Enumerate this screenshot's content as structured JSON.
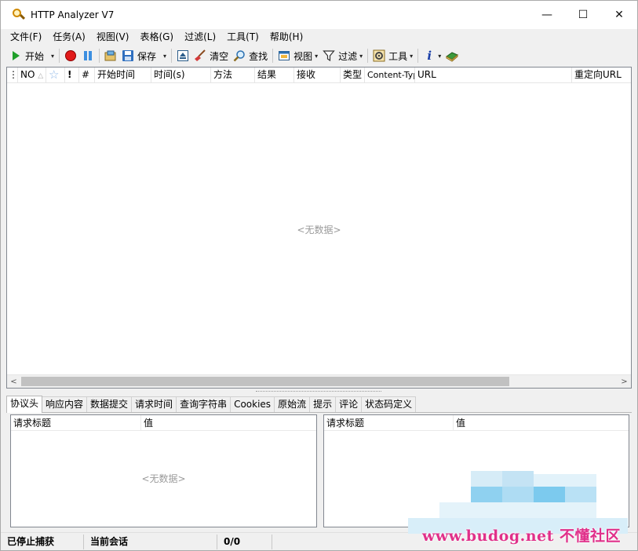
{
  "window": {
    "title": "HTTP Analyzer V7",
    "minimize_glyph": "—",
    "maximize_glyph": "☐",
    "close_glyph": "✕"
  },
  "menu": [
    "文件(F)",
    "任务(A)",
    "视图(V)",
    "表格(G)",
    "过滤(L)",
    "工具(T)",
    "帮助(H)"
  ],
  "toolbar": {
    "start": "开始",
    "save": "保存",
    "clear": "清空",
    "find": "查找",
    "view": "视图",
    "filter": "过滤",
    "tools": "工具",
    "info_glyph": "i",
    "dropdown_glyph": "▾"
  },
  "grid": {
    "columns": [
      "NO",
      "☆",
      "!",
      "#",
      "开始时间",
      "时间(s)",
      "方法",
      "结果",
      "接收",
      "类型",
      "Content-Typ",
      "URL",
      "重定向URL"
    ],
    "sort_indicator": "△",
    "empty_text": "<无数据>",
    "scroll_left": "<",
    "scroll_right": ">"
  },
  "tabs": [
    "协议头",
    "响应内容",
    "数据提交",
    "请求时间",
    "查询字符串",
    "Cookies",
    "原始流",
    "提示",
    "评论",
    "状态码定义"
  ],
  "active_tab": "协议头",
  "left_pane": {
    "col_name": "请求标题",
    "col_value": "值",
    "empty_text": "<无数据>"
  },
  "right_pane": {
    "col_name": "请求标题",
    "col_value": "值"
  },
  "status": {
    "capture_state": "已停止捕获",
    "current_session": "当前会话",
    "count": "0/0"
  },
  "watermark": {
    "text": "www.budog.net 不懂社区",
    "color": "#e0308a"
  },
  "colors": {
    "accent_green": "#1f9f2a",
    "record_red": "#e11a1a",
    "pause_blue": "#3c8fe0"
  }
}
